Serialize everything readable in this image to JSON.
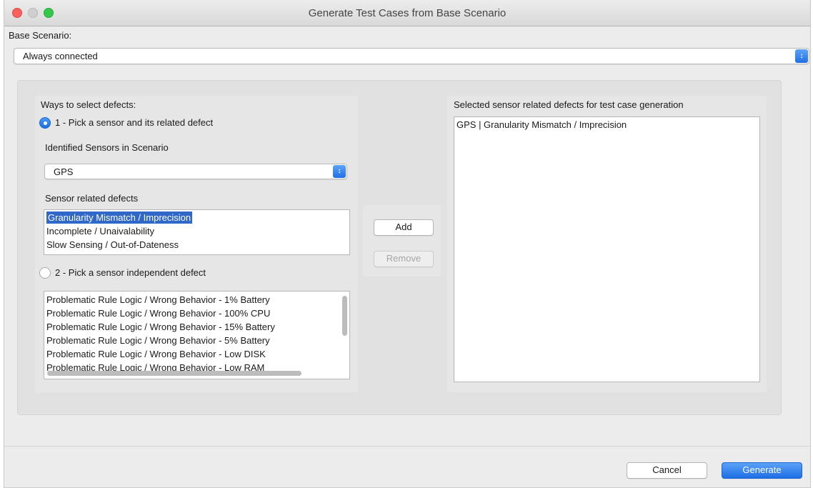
{
  "window": {
    "title": "Generate Test Cases from Base Scenario"
  },
  "base_scenario": {
    "label": "Base Scenario:",
    "selected": "Always connected"
  },
  "left": {
    "ways_label": "Ways to select defects:",
    "option1_label": "1 - Pick a sensor and its related defect",
    "option1_checked": true,
    "sensors_label": "Identified Sensors in Scenario",
    "sensor_selected": "GPS",
    "defects_label": "Sensor related defects",
    "defects": [
      "Granularity Mismatch / Imprecision",
      "Incomplete / Unaivalability",
      "Slow Sensing / Out-of-Dateness"
    ],
    "defects_selected_index": 0,
    "option2_label": "2 - Pick a sensor independent defect",
    "option2_checked": false,
    "independent_defects": [
      "Problematic Rule Logic / Wrong Behavior - 1% Battery",
      "Problematic Rule Logic / Wrong Behavior - 100% CPU",
      "Problematic Rule Logic / Wrong Behavior - 15% Battery",
      "Problematic Rule Logic / Wrong Behavior - 5% Battery",
      "Problematic Rule Logic / Wrong Behavior - Low DISK",
      "Problematic Rule Logic / Wrong Behavior - Low RAM"
    ]
  },
  "middle": {
    "add_label": "Add",
    "remove_label": "Remove"
  },
  "right": {
    "label": "Selected sensor related defects for test case generation",
    "items": [
      "GPS | Granularity Mismatch / Imprecision"
    ]
  },
  "footer": {
    "cancel_label": "Cancel",
    "generate_label": "Generate"
  },
  "colors": {
    "accent": "#1e6ee6",
    "selection": "#2f68c8",
    "window_bg": "#ececec"
  }
}
